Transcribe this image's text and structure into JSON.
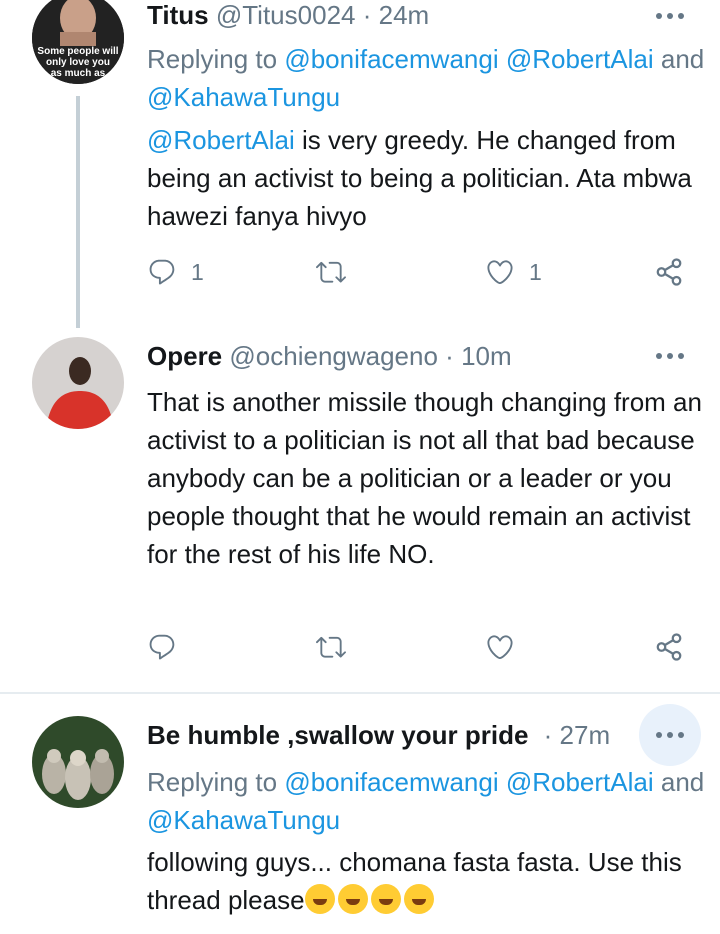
{
  "tweets": [
    {
      "name": "Titus",
      "handle": "@Titus0024",
      "dot": "·",
      "time": "24m",
      "reply_prefix": "Replying to",
      "reply_handle1": "@bonifacemwangi",
      "reply_handle2": "@RobertAlai",
      "reply_and": "and",
      "reply_handle3": "@KahawaTungu",
      "mention": "@RobertAlai",
      "text_after_mention": " is very greedy. He changed from being an activist to being a politician. Ata mbwa hawezi fanya hivyo",
      "avatar_text": "Some people will only love you as much as",
      "reply_count": "1",
      "like_count": "1"
    },
    {
      "name": "Opere",
      "handle": "@ochiengwageno",
      "dot": "·",
      "time": "10m",
      "text": "That is another missile though changing from an activist to a politician is not all that bad because anybody can be a politician or a leader or you people thought that he would remain an activist for the rest of his life NO."
    },
    {
      "name": "Be humble ,swallow your pride",
      "dot": "·",
      "time": "27m",
      "reply_prefix": "Replying to",
      "reply_handle1": "@bonifacemwangi",
      "reply_handle2": "@RobertAlai",
      "reply_and": "and",
      "reply_handle3": "@KahawaTungu",
      "text": "following guys... chomana fasta fasta. Use this thread please",
      "emoji_count": 4
    }
  ],
  "icons": {
    "reply": "reply-icon",
    "retweet": "retweet-icon",
    "like": "heart-icon",
    "share": "share-icon",
    "more": "more-icon",
    "emoji": "rolling-on-floor-laughing-emoji"
  },
  "colors": {
    "link": "#1b95e0",
    "muted": "#657786",
    "text": "#14171a",
    "thread_line": "#c4cfd6",
    "divider": "#e6ecf0",
    "more_highlight": "#e8f1fb"
  }
}
